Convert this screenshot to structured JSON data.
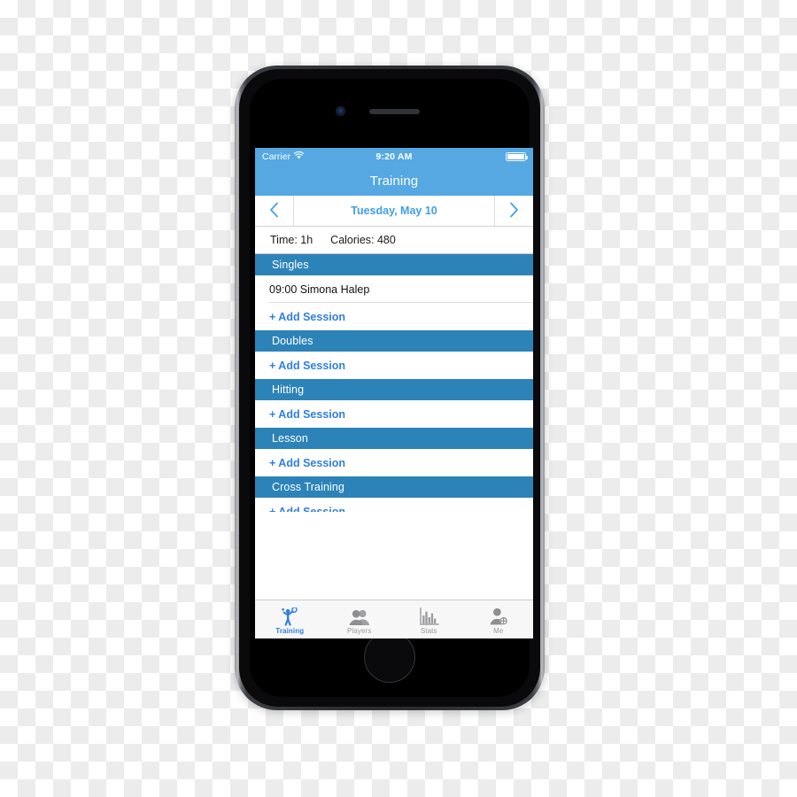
{
  "device": {
    "frame_name": "iphone-6-space-gray",
    "camera": "front-camera",
    "speaker": "earpiece-speaker",
    "home_button": "home-button"
  },
  "colors": {
    "nav_blue": "#55a8e2",
    "section_blue": "#2c83b8",
    "link_blue": "#2f7fe0",
    "date_blue": "#3f9fe8",
    "tab_inactive": "#9a9a9f",
    "list_background": "#efeff4"
  },
  "status_bar": {
    "carrier": "Carrier",
    "wifi_icon": "wifi-icon",
    "time": "9:20 AM",
    "battery_icon": "battery-icon",
    "battery_level": 100
  },
  "nav_bar": {
    "title": "Training"
  },
  "date_nav": {
    "prev_icon": "chevron-left-icon",
    "next_icon": "chevron-right-icon",
    "date": "Tuesday, May 10"
  },
  "summary": {
    "time": "Time: 1h",
    "calories": "Calories: 480"
  },
  "sections": [
    {
      "title": "Singles",
      "rows": [
        {
          "type": "session",
          "text": "09:00 Simona Halep"
        },
        {
          "type": "add",
          "text": "+ Add Session"
        }
      ]
    },
    {
      "title": "Doubles",
      "rows": [
        {
          "type": "add",
          "text": "+ Add Session"
        }
      ]
    },
    {
      "title": "Hitting",
      "rows": [
        {
          "type": "add",
          "text": "+ Add Session"
        }
      ]
    },
    {
      "title": "Lesson",
      "rows": [
        {
          "type": "add",
          "text": "+ Add Session"
        }
      ]
    },
    {
      "title": "Cross Training",
      "rows": [
        {
          "type": "add",
          "text": "+ Add Session"
        }
      ]
    }
  ],
  "tab_bar": {
    "items": [
      {
        "label": "Training",
        "icon": "tennis-player-icon",
        "active": true
      },
      {
        "label": "Players",
        "icon": "two-people-icon",
        "active": false
      },
      {
        "label": "Stats",
        "icon": "bar-chart-icon",
        "active": false
      },
      {
        "label": "Me",
        "icon": "person-add-icon",
        "active": false
      }
    ]
  }
}
